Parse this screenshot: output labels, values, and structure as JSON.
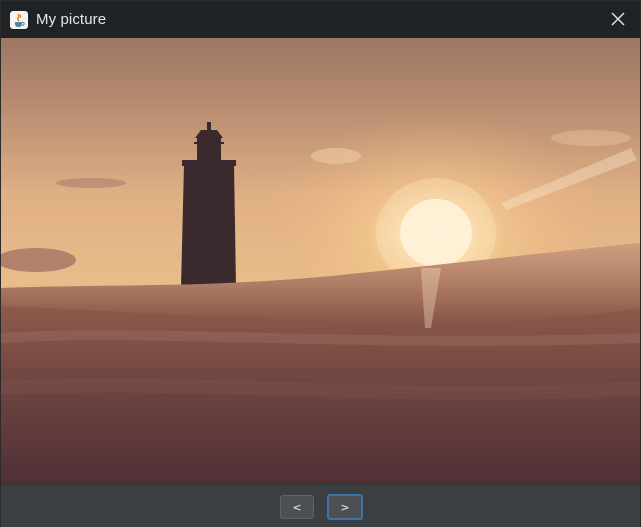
{
  "window": {
    "title": "My picture",
    "icon": "java-cup-icon",
    "close_icon": "close-icon"
  },
  "picture": {
    "icon": "photo-image"
  },
  "navigation": {
    "prev_label": "<",
    "next_label": ">",
    "focused": "next"
  },
  "colors": {
    "titlebar": "#1f2326",
    "panel": "#3c3f41",
    "focus_border": "#3d74a8"
  }
}
